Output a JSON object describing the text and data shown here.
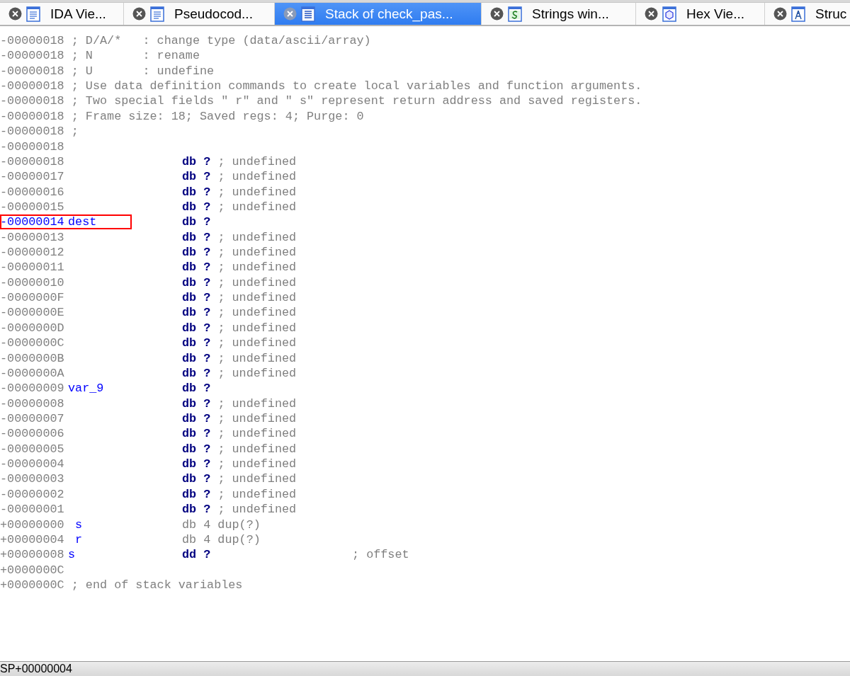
{
  "tabs": [
    {
      "label": "IDA Vie...",
      "kind": "doc",
      "selected": false
    },
    {
      "label": "Pseudocod...",
      "kind": "doc",
      "selected": false
    },
    {
      "label": "Stack of check_pas...",
      "kind": "stack",
      "selected": true
    },
    {
      "label": "Strings win...",
      "kind": "strings",
      "selected": false
    },
    {
      "label": "Hex Vie...",
      "kind": "hex",
      "selected": false
    },
    {
      "label": "Struc",
      "kind": "struct",
      "selected": false
    }
  ],
  "lines": [
    {
      "kind": "comment",
      "address": "-00000018",
      "text": "; D/A/*   : change type (data/ascii/array)",
      "highlighted": false
    },
    {
      "kind": "comment",
      "address": "-00000018",
      "text": "; N       : rename",
      "highlighted": false
    },
    {
      "kind": "comment",
      "address": "-00000018",
      "text": "; U       : undefine",
      "highlighted": false
    },
    {
      "kind": "comment",
      "address": "-00000018",
      "text": "; Use data definition commands to create local variables and function arguments.",
      "highlighted": false
    },
    {
      "kind": "comment",
      "address": "-00000018",
      "text": "; Two special fields \" r\" and \" s\" represent return address and saved registers.",
      "highlighted": false
    },
    {
      "kind": "comment",
      "address": "-00000018",
      "text": "; Frame size: 18; Saved regs: 4; Purge: 0",
      "highlighted": false
    },
    {
      "kind": "comment",
      "address": "-00000018",
      "text": ";",
      "highlighted": false
    },
    {
      "kind": "comment",
      "address": "-00000018",
      "highlighted": false
    },
    {
      "kind": "var",
      "address": "-00000018",
      "type": "db ?",
      "comment": "; undefined",
      "highlighted": false
    },
    {
      "kind": "var",
      "address": "-00000017",
      "type": "db ?",
      "comment": "; undefined",
      "highlighted": false
    },
    {
      "kind": "var",
      "address": "-00000016",
      "type": "db ?",
      "comment": "; undefined",
      "highlighted": false
    },
    {
      "kind": "var",
      "address": "-00000015",
      "type": "db ?",
      "comment": "; undefined",
      "highlighted": false
    },
    {
      "kind": "var",
      "address": "-00000014",
      "name": "dest",
      "type": "db ?",
      "highlighted": true
    },
    {
      "kind": "var",
      "address": "-00000013",
      "type": "db ?",
      "comment": "; undefined",
      "highlighted": false
    },
    {
      "kind": "var",
      "address": "-00000012",
      "type": "db ?",
      "comment": "; undefined",
      "highlighted": false
    },
    {
      "kind": "var",
      "address": "-00000011",
      "type": "db ?",
      "comment": "; undefined",
      "highlighted": false
    },
    {
      "kind": "var",
      "address": "-00000010",
      "type": "db ?",
      "comment": "; undefined",
      "highlighted": false
    },
    {
      "kind": "var",
      "address": "-0000000F",
      "type": "db ?",
      "comment": "; undefined",
      "highlighted": false
    },
    {
      "kind": "var",
      "address": "-0000000E",
      "type": "db ?",
      "comment": "; undefined",
      "highlighted": false
    },
    {
      "kind": "var",
      "address": "-0000000D",
      "type": "db ?",
      "comment": "; undefined",
      "highlighted": false
    },
    {
      "kind": "var",
      "address": "-0000000C",
      "type": "db ?",
      "comment": "; undefined",
      "highlighted": false
    },
    {
      "kind": "var",
      "address": "-0000000B",
      "type": "db ?",
      "comment": "; undefined",
      "highlighted": false
    },
    {
      "kind": "var",
      "address": "-0000000A",
      "type": "db ?",
      "comment": "; undefined",
      "highlighted": false
    },
    {
      "kind": "var",
      "address": "-00000009",
      "name": "var_9",
      "type": "db ?",
      "highlighted": false
    },
    {
      "kind": "var",
      "address": "-00000008",
      "type": "db ?",
      "comment": "; undefined",
      "highlighted": false
    },
    {
      "kind": "var",
      "address": "-00000007",
      "type": "db ?",
      "comment": "; undefined",
      "highlighted": false
    },
    {
      "kind": "var",
      "address": "-00000006",
      "type": "db ?",
      "comment": "; undefined",
      "highlighted": false
    },
    {
      "kind": "var",
      "address": "-00000005",
      "type": "db ?",
      "comment": "; undefined",
      "highlighted": false
    },
    {
      "kind": "var",
      "address": "-00000004",
      "type": "db ?",
      "comment": "; undefined",
      "highlighted": false
    },
    {
      "kind": "var",
      "address": "-00000003",
      "type": "db ?",
      "comment": "; undefined",
      "highlighted": false
    },
    {
      "kind": "var",
      "address": "-00000002",
      "type": "db ?",
      "comment": "; undefined",
      "highlighted": false
    },
    {
      "kind": "var",
      "address": "-00000001",
      "type": "db ?",
      "comment": "; undefined",
      "highlighted": false
    },
    {
      "kind": "saved",
      "address": "+00000000",
      "name": "s",
      "type": "db 4 dup(?)",
      "highlighted": false
    },
    {
      "kind": "saved",
      "address": "+00000004",
      "name": "r",
      "type": "db 4 dup(?)",
      "highlighted": false
    },
    {
      "kind": "pointer",
      "address": "+00000008",
      "name": "s",
      "type": "dd ?",
      "comment": "; offset",
      "highlighted": false
    },
    {
      "kind": "comment",
      "address": "+0000000C",
      "highlighted": false
    },
    {
      "kind": "comment",
      "address": "+0000000C",
      "text": "; end of stack variables",
      "highlighted": false
    }
  ],
  "status_bar": {
    "text": "SP+00000004"
  }
}
